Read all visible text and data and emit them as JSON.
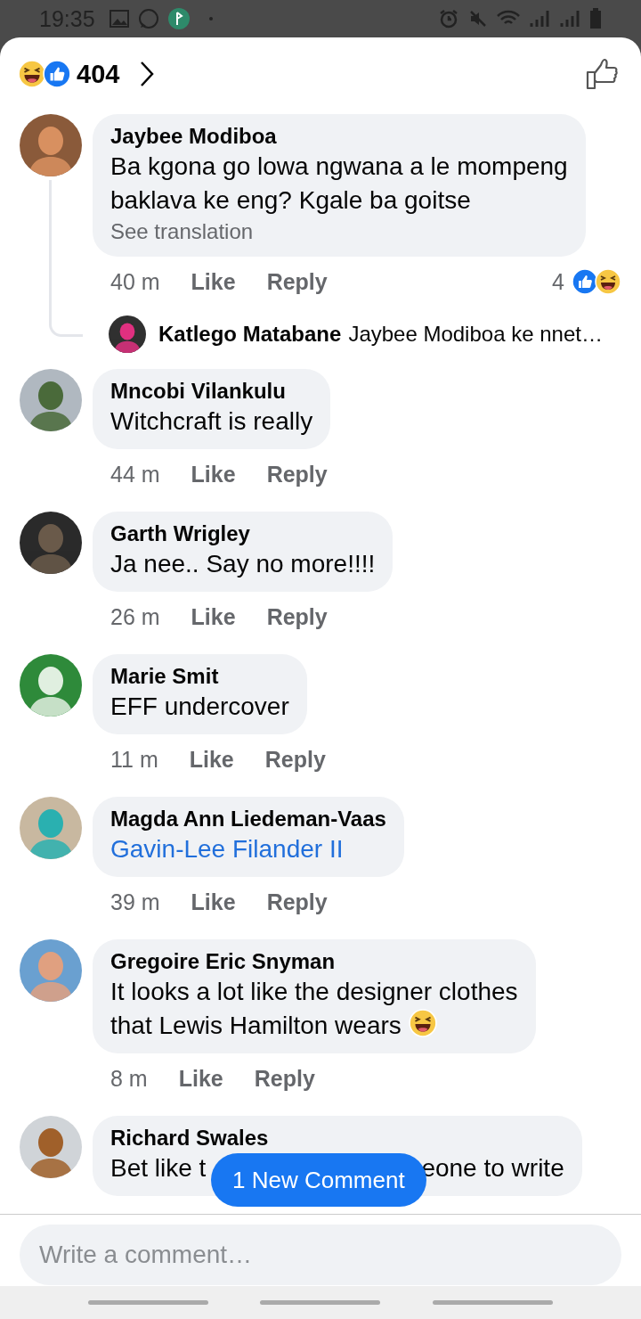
{
  "status_bar": {
    "time": "19:35"
  },
  "header": {
    "reaction_count": "404"
  },
  "comments": [
    {
      "kind": "plain",
      "author": "Jaybee Modiboa",
      "lines": [
        "Ba kgona go lowa ngwana a le mompeng",
        "baklava ke eng? Kgale ba goitse"
      ],
      "see_translation": "See translation",
      "time": "40 m",
      "like": "Like",
      "reply": "Reply",
      "reaction_count": "4",
      "replies": [
        {
          "author": "Katlego Matabane",
          "text": "Jaybee Modiboa ke nnet…"
        }
      ]
    },
    {
      "kind": "plain",
      "author": "Mncobi Vilankulu",
      "text": "Witchcraft is really",
      "time": "44 m",
      "like": "Like",
      "reply": "Reply"
    },
    {
      "kind": "plain",
      "author": "Garth Wrigley",
      "text": "Ja nee.. Say no more!!!!",
      "time": "26 m",
      "like": "Like",
      "reply": "Reply"
    },
    {
      "kind": "plain",
      "author": "Marie Smit",
      "text": "EFF undercover",
      "time": "11 m",
      "like": "Like",
      "reply": "Reply"
    },
    {
      "kind": "link",
      "author": "Magda Ann Liedeman-Vaas",
      "text": "Gavin-Lee Filander II",
      "time": "39 m",
      "like": "Like",
      "reply": "Reply"
    },
    {
      "kind": "plain",
      "author": "Gregoire Eric Snyman",
      "lines": [
        "It looks a lot like the designer clothes",
        "that Lewis Hamilton wears"
      ],
      "laugh_emoji": true,
      "time": "8 m",
      "like": "Like",
      "reply": "Reply"
    },
    {
      "kind": "covered",
      "author": "Richard Swales",
      "text_parts": [
        "Bet like t",
        "eone to write"
      ]
    }
  ],
  "new_comment_pill": "1 New Comment",
  "composer": {
    "placeholder": "Write a comment…"
  }
}
